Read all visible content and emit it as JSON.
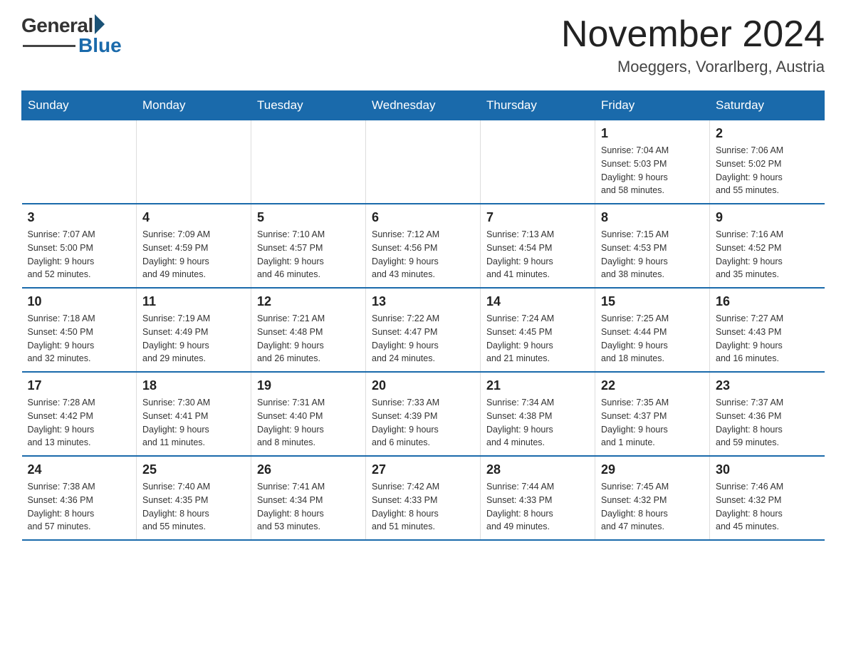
{
  "logo": {
    "general_text": "General",
    "blue_text": "Blue"
  },
  "header": {
    "month_year": "November 2024",
    "location": "Moeggers, Vorarlberg, Austria"
  },
  "weekdays": [
    "Sunday",
    "Monday",
    "Tuesday",
    "Wednesday",
    "Thursday",
    "Friday",
    "Saturday"
  ],
  "weeks": [
    [
      {
        "day": "",
        "info": ""
      },
      {
        "day": "",
        "info": ""
      },
      {
        "day": "",
        "info": ""
      },
      {
        "day": "",
        "info": ""
      },
      {
        "day": "",
        "info": ""
      },
      {
        "day": "1",
        "info": "Sunrise: 7:04 AM\nSunset: 5:03 PM\nDaylight: 9 hours\nand 58 minutes."
      },
      {
        "day": "2",
        "info": "Sunrise: 7:06 AM\nSunset: 5:02 PM\nDaylight: 9 hours\nand 55 minutes."
      }
    ],
    [
      {
        "day": "3",
        "info": "Sunrise: 7:07 AM\nSunset: 5:00 PM\nDaylight: 9 hours\nand 52 minutes."
      },
      {
        "day": "4",
        "info": "Sunrise: 7:09 AM\nSunset: 4:59 PM\nDaylight: 9 hours\nand 49 minutes."
      },
      {
        "day": "5",
        "info": "Sunrise: 7:10 AM\nSunset: 4:57 PM\nDaylight: 9 hours\nand 46 minutes."
      },
      {
        "day": "6",
        "info": "Sunrise: 7:12 AM\nSunset: 4:56 PM\nDaylight: 9 hours\nand 43 minutes."
      },
      {
        "day": "7",
        "info": "Sunrise: 7:13 AM\nSunset: 4:54 PM\nDaylight: 9 hours\nand 41 minutes."
      },
      {
        "day": "8",
        "info": "Sunrise: 7:15 AM\nSunset: 4:53 PM\nDaylight: 9 hours\nand 38 minutes."
      },
      {
        "day": "9",
        "info": "Sunrise: 7:16 AM\nSunset: 4:52 PM\nDaylight: 9 hours\nand 35 minutes."
      }
    ],
    [
      {
        "day": "10",
        "info": "Sunrise: 7:18 AM\nSunset: 4:50 PM\nDaylight: 9 hours\nand 32 minutes."
      },
      {
        "day": "11",
        "info": "Sunrise: 7:19 AM\nSunset: 4:49 PM\nDaylight: 9 hours\nand 29 minutes."
      },
      {
        "day": "12",
        "info": "Sunrise: 7:21 AM\nSunset: 4:48 PM\nDaylight: 9 hours\nand 26 minutes."
      },
      {
        "day": "13",
        "info": "Sunrise: 7:22 AM\nSunset: 4:47 PM\nDaylight: 9 hours\nand 24 minutes."
      },
      {
        "day": "14",
        "info": "Sunrise: 7:24 AM\nSunset: 4:45 PM\nDaylight: 9 hours\nand 21 minutes."
      },
      {
        "day": "15",
        "info": "Sunrise: 7:25 AM\nSunset: 4:44 PM\nDaylight: 9 hours\nand 18 minutes."
      },
      {
        "day": "16",
        "info": "Sunrise: 7:27 AM\nSunset: 4:43 PM\nDaylight: 9 hours\nand 16 minutes."
      }
    ],
    [
      {
        "day": "17",
        "info": "Sunrise: 7:28 AM\nSunset: 4:42 PM\nDaylight: 9 hours\nand 13 minutes."
      },
      {
        "day": "18",
        "info": "Sunrise: 7:30 AM\nSunset: 4:41 PM\nDaylight: 9 hours\nand 11 minutes."
      },
      {
        "day": "19",
        "info": "Sunrise: 7:31 AM\nSunset: 4:40 PM\nDaylight: 9 hours\nand 8 minutes."
      },
      {
        "day": "20",
        "info": "Sunrise: 7:33 AM\nSunset: 4:39 PM\nDaylight: 9 hours\nand 6 minutes."
      },
      {
        "day": "21",
        "info": "Sunrise: 7:34 AM\nSunset: 4:38 PM\nDaylight: 9 hours\nand 4 minutes."
      },
      {
        "day": "22",
        "info": "Sunrise: 7:35 AM\nSunset: 4:37 PM\nDaylight: 9 hours\nand 1 minute."
      },
      {
        "day": "23",
        "info": "Sunrise: 7:37 AM\nSunset: 4:36 PM\nDaylight: 8 hours\nand 59 minutes."
      }
    ],
    [
      {
        "day": "24",
        "info": "Sunrise: 7:38 AM\nSunset: 4:36 PM\nDaylight: 8 hours\nand 57 minutes."
      },
      {
        "day": "25",
        "info": "Sunrise: 7:40 AM\nSunset: 4:35 PM\nDaylight: 8 hours\nand 55 minutes."
      },
      {
        "day": "26",
        "info": "Sunrise: 7:41 AM\nSunset: 4:34 PM\nDaylight: 8 hours\nand 53 minutes."
      },
      {
        "day": "27",
        "info": "Sunrise: 7:42 AM\nSunset: 4:33 PM\nDaylight: 8 hours\nand 51 minutes."
      },
      {
        "day": "28",
        "info": "Sunrise: 7:44 AM\nSunset: 4:33 PM\nDaylight: 8 hours\nand 49 minutes."
      },
      {
        "day": "29",
        "info": "Sunrise: 7:45 AM\nSunset: 4:32 PM\nDaylight: 8 hours\nand 47 minutes."
      },
      {
        "day": "30",
        "info": "Sunrise: 7:46 AM\nSunset: 4:32 PM\nDaylight: 8 hours\nand 45 minutes."
      }
    ]
  ]
}
